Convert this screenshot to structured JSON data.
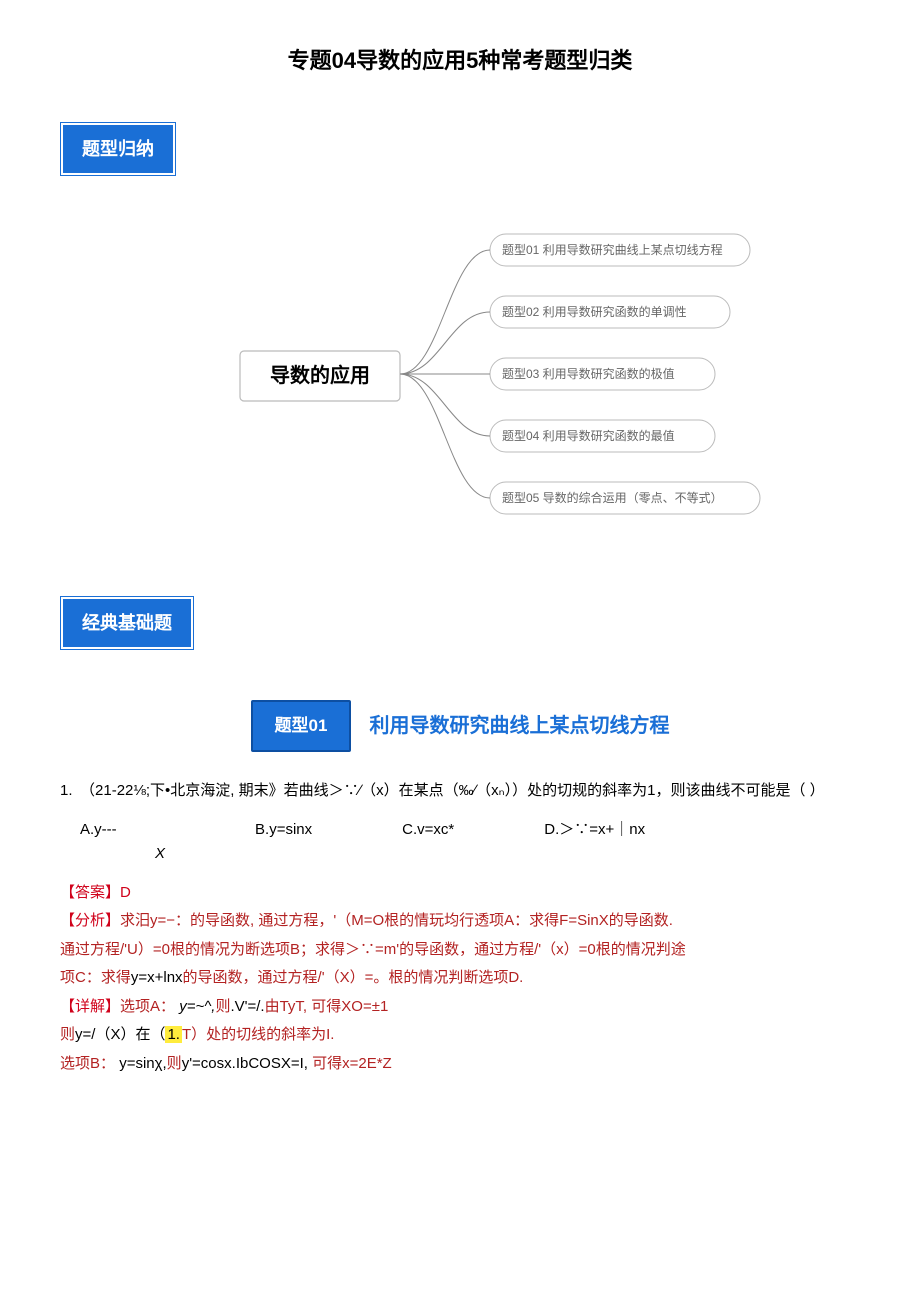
{
  "title": "专题04导数的应用5种常考题型归类",
  "tags": {
    "section1": "题型归纳",
    "section2": "经典基础题"
  },
  "mindmap": {
    "center": "导数的应用",
    "nodes": [
      "题型01 利用导数研究曲线上某点切线方程",
      "题型02 利用导数研究函数的单调性",
      "题型03 利用导数研究函数的极值",
      "题型04 利用导数研究函数的最值",
      "题型05 导数的综合运用（零点、不等式）"
    ]
  },
  "topic": {
    "badge": "题型01",
    "title": "利用导数研究曲线上某点切线方程"
  },
  "problem": {
    "stem": "1.　（21-22⅛;下•北京海淀, 期末》若曲线＞∵∕（x）在某点（‰∕（xₙ））处的切规的斜率为1，则该曲线不可能是（ ）",
    "options": {
      "A": "A.y---",
      "A_sub": "X",
      "B": "B.y=sinx",
      "C": "C.v=xc*",
      "D": "D.＞∵=x+｜nx"
    },
    "answer_label": "【答案】",
    "answer_value": "D",
    "analysis_label": "【分析】",
    "analysis_body": "求汨y=−：的导函数, 通过方程，'（M=O根的情玩均行透项A：求得F=SinX的导函数.",
    "analysis_line2": "通过方程/'U）=0根的情况为断选项B；求得＞∵=m'的导函数，通过方程/'（x）=0根的情况判途",
    "analysis_line3_a": "项C：求得",
    "analysis_line3_b": "y=x+lnx",
    "analysis_line3_c": "的导函数，通过方程/'（X）=。根的情况判断选项D.",
    "detail_label": "【详解】",
    "detail_a1": "选项A：",
    "detail_a2": "y=~^,",
    "detail_a3": "则",
    "detail_a4": ".V'=/.",
    "detail_a5": "由TyT,",
    "detail_a6": "可得XO=±1",
    "detail_line2_a": "则",
    "detail_line2_b": "y=/（X）在（",
    "detail_hl": "1.",
    "detail_line2_c": "T）处的切线的斜率为I.",
    "detail_b1": "选项B：",
    "detail_b2": "y=sinχ,",
    "detail_b3": "则",
    "detail_b4": "y'=cosx.IbCOSX=I,",
    "detail_b5": "可得x=2E*Z"
  }
}
